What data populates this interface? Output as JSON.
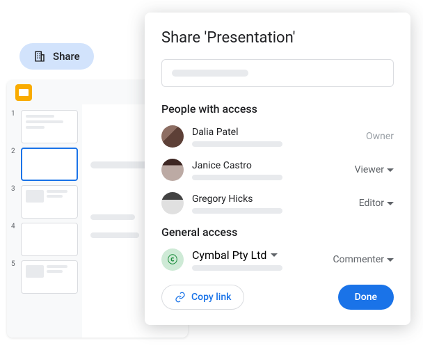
{
  "pill": {
    "label": "Share"
  },
  "dialog": {
    "title": "Share 'Presentation'",
    "sections": {
      "people_title": "People with access",
      "general_title": "General access"
    },
    "people": [
      {
        "name": "Dalia Patel",
        "role": "Owner"
      },
      {
        "name": "Janice Castro",
        "role": "Viewer"
      },
      {
        "name": "Gregory Hicks",
        "role": "Editor"
      }
    ],
    "general": {
      "name": "Cymbal Pty Ltd",
      "role": "Commenter"
    },
    "copy_link": "Copy link",
    "done": "Done"
  },
  "thumbs": [
    "1",
    "2",
    "3",
    "4",
    "5"
  ]
}
